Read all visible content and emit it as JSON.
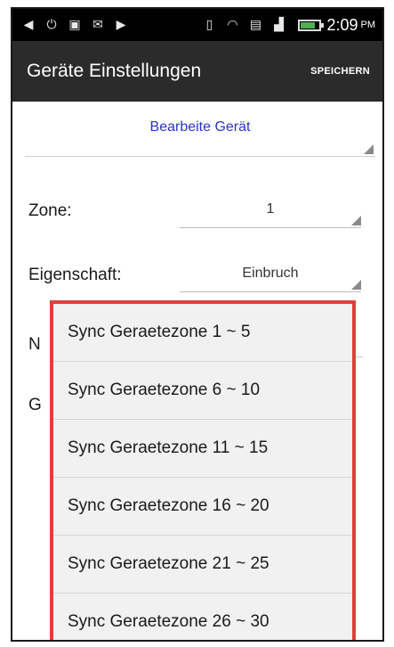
{
  "status_bar": {
    "icons": [
      "app-icon",
      "alarm-icon",
      "image-icon",
      "mail-icon",
      "store-icon",
      "vibrate-icon",
      "wifi-icon",
      "cast-icon",
      "signal-icon",
      "battery-icon"
    ],
    "time": "2:09",
    "ampm": "PM"
  },
  "action_bar": {
    "title": "Geräte Einstellungen",
    "save_label": "SPEICHERN"
  },
  "form": {
    "device_selector": "Bearbeite Gerät",
    "zone_label": "Zone:",
    "zone_value": "1",
    "property_label": "Eigenschaft:",
    "property_value": "Einbruch",
    "obscured_label_1": "N",
    "obscured_label_2": "G"
  },
  "dropdown": {
    "items": [
      "Sync Geraetezone 1 ~ 5",
      "Sync Geraetezone 6 ~ 10",
      "Sync Geraetezone 11 ~ 15",
      "Sync Geraetezone 16 ~ 20",
      "Sync Geraetezone 21 ~ 25",
      "Sync Geraetezone 26 ~ 30"
    ]
  },
  "colors": {
    "action_bar": "#2b2b2b",
    "link_blue": "#2a33c8",
    "highlight_border": "#e0403a",
    "battery_green": "#4caf50"
  }
}
